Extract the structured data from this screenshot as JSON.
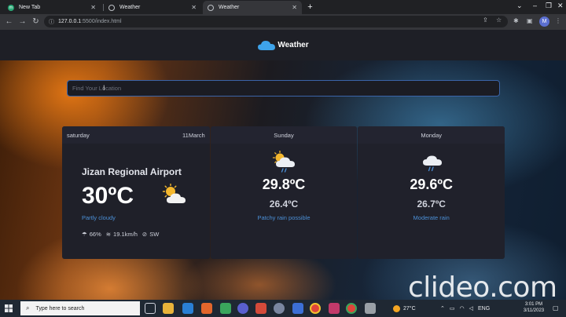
{
  "browser": {
    "tabs": [
      {
        "title": "New Tab",
        "active": false
      },
      {
        "title": "Weather",
        "active": false
      },
      {
        "title": "Weather",
        "active": true
      }
    ],
    "url_host": "127.0.0.1",
    "url_rest": ":5500/index.html",
    "profile_initial": "M"
  },
  "app": {
    "name": "Weather",
    "search_placeholder": "Find Your Location"
  },
  "today": {
    "day": "saturday",
    "date": "11March",
    "location": "Jizan Regional Airport",
    "temperature": "30ºC",
    "condition": "Partly cloudy",
    "humidity": "66%",
    "wind_speed": "19.1km/h",
    "wind_direction": "SW"
  },
  "forecast": [
    {
      "day": "Sunday",
      "max": "29.8ºC",
      "min": "26.4ºC",
      "condition": "Patchy rain possible"
    },
    {
      "day": "Monday",
      "max": "29.6ºC",
      "min": "26.7ºC",
      "condition": "Moderate rain"
    }
  ],
  "watermark": "clideo.com",
  "taskbar": {
    "search_placeholder": "Type here to search",
    "weather_temp": "27°C",
    "language": "ENG",
    "time": "3:01 PM",
    "date": "3/11/2023"
  }
}
